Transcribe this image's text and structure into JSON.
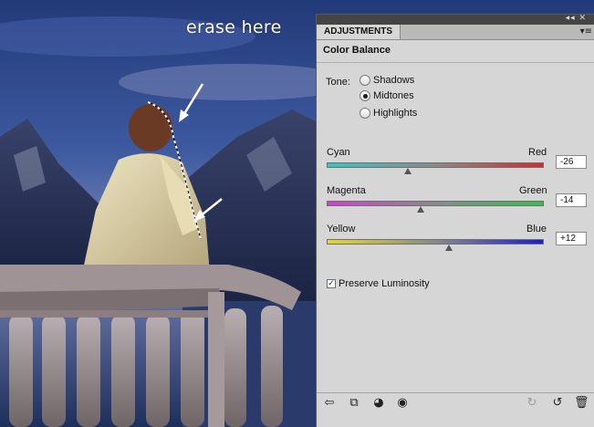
{
  "annotation": {
    "text": "erase here"
  },
  "panel": {
    "tab_label": "ADJUSTMENTS",
    "heading": "Color Balance",
    "tone": {
      "label": "Tone:",
      "options": [
        {
          "label": "Shadows",
          "selected": false
        },
        {
          "label": "Midtones",
          "selected": true
        },
        {
          "label": "Highlights",
          "selected": false
        }
      ]
    },
    "sliders": [
      {
        "left_label": "Cyan",
        "right_label": "Red",
        "value": "-26",
        "color_left": "#33c7c7",
        "color_right": "#d62a2a"
      },
      {
        "left_label": "Magenta",
        "right_label": "Green",
        "value": "-14",
        "color_left": "#d43bd4",
        "color_right": "#2fc34a"
      },
      {
        "left_label": "Yellow",
        "right_label": "Blue",
        "value": "+12",
        "color_left": "#e3d92a",
        "color_right": "#1a1fd0"
      }
    ],
    "preserve_luminosity": {
      "label": "Preserve Luminosity",
      "checked": true
    }
  }
}
